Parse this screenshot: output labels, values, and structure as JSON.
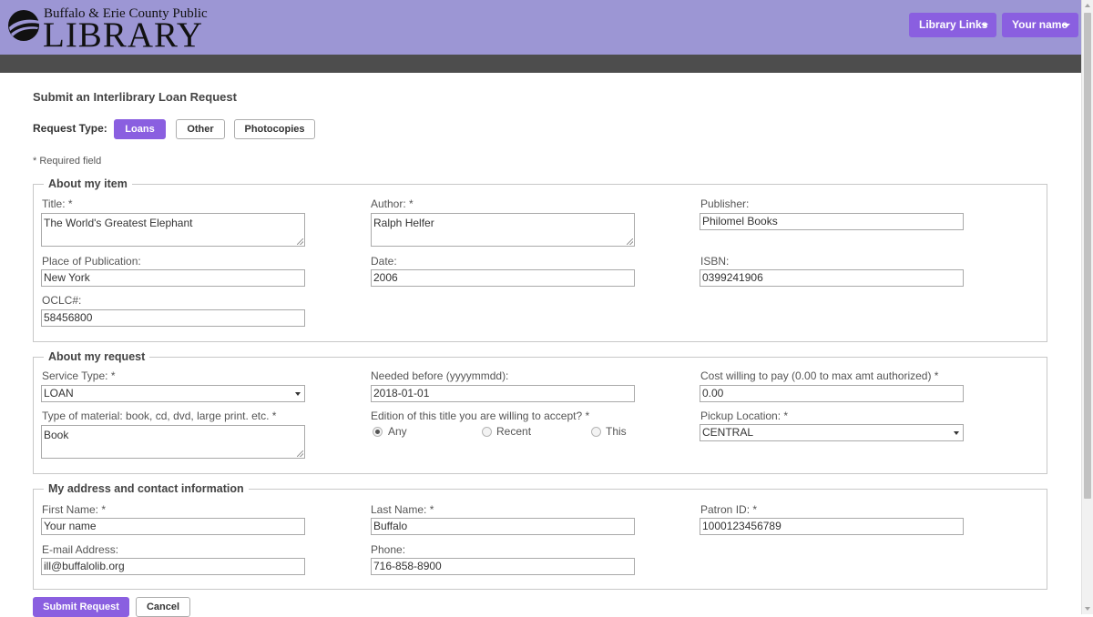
{
  "header": {
    "logo_small": "Buffalo & Erie County Public",
    "logo_big": "LIBRARY",
    "library_links": "Library Links",
    "user_name": "Your name"
  },
  "colors": {
    "header_bg": "#9c96d4",
    "accent": "#8a5fe0",
    "subbar": "#4d4d4d"
  },
  "page": {
    "title": "Submit an Interlibrary Loan Request",
    "request_type_label": "Request Type:",
    "request_types": [
      "Loans",
      "Other",
      "Photocopies"
    ],
    "selected_request_type": "Loans",
    "required_note": "* Required field"
  },
  "item": {
    "legend": "About my item",
    "title_label": "Title:  *",
    "title_value": "The World's Greatest Elephant",
    "author_label": "Author:  *",
    "author_value": "Ralph Helfer",
    "publisher_label": "Publisher:",
    "publisher_value": "Philomel Books",
    "place_label": "Place of Publication:",
    "place_value": "New York",
    "date_label": "Date:",
    "date_value": "2006",
    "isbn_label": "ISBN:",
    "isbn_value": "0399241906",
    "oclc_label": "OCLC#:",
    "oclc_value": "58456800"
  },
  "request": {
    "legend": "About my request",
    "service_label": "Service Type:  *",
    "service_value": "LOAN",
    "needed_label": "Needed before (yyyymmdd):",
    "needed_value": "2018-01-01",
    "cost_label": "Cost willing to pay (0.00 to max amt authorized)  *",
    "cost_value": "0.00",
    "material_label": "Type of material: book, cd, dvd, large print. etc.  *",
    "material_value": "Book",
    "edition_label": "Edition of this title you are willing to accept?  *",
    "edition_options": [
      "Any",
      "Recent",
      "This"
    ],
    "edition_selected": "Any",
    "pickup_label": "Pickup Location:  *",
    "pickup_value": "CENTRAL"
  },
  "contact": {
    "legend": "My address and contact information",
    "first_label": "First Name:  *",
    "first_value": "Your name",
    "last_label": "Last Name:  *",
    "last_value": "Buffalo",
    "patron_label": "Patron ID:  *",
    "patron_value": "1000123456789",
    "email_label": "E-mail Address:",
    "email_value": "ill@buffalolib.org",
    "phone_label": "Phone:",
    "phone_value": "716-858-8900"
  },
  "actions": {
    "submit": "Submit Request",
    "cancel": "Cancel"
  }
}
